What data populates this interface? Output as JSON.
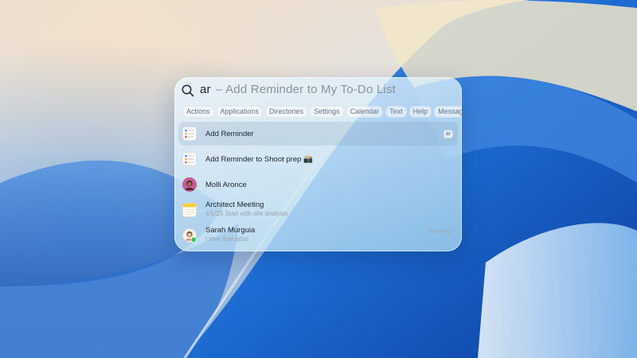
{
  "spotlight": {
    "query": "ar",
    "suggestion": "– Add  Reminder  to  My To-Do List",
    "filters": [
      {
        "label": "Actions"
      },
      {
        "label": "Applications"
      },
      {
        "label": "Directories"
      },
      {
        "label": "Settings"
      },
      {
        "label": "Calendar"
      },
      {
        "label": "Text"
      },
      {
        "label": "Help"
      },
      {
        "label": "Messag"
      }
    ],
    "results": [
      {
        "icon": "reminders-app-icon",
        "title": "Add Reminder",
        "shortcut": "ar",
        "selected": true
      },
      {
        "icon": "reminders-app-icon",
        "title": "Add Reminder to Shoot prep 📸",
        "selected": false
      },
      {
        "icon": "contact-avatar-icon",
        "title": "Molli Aronce",
        "selected": false
      },
      {
        "icon": "notes-app-icon",
        "title": "Architect Meeting",
        "subtitle": "4/1/25 Start with site analysis",
        "selected": false
      },
      {
        "icon": "messages-avatar-icon",
        "title": "Sarah Murguia",
        "subtitle": "I love that artist",
        "meta": "Yesterday",
        "selected": false
      }
    ]
  },
  "colors": {
    "accent_blue": "#1f6fd6",
    "panel_tint": "#d6ecf8",
    "selected_row": "#a7b9cb"
  }
}
